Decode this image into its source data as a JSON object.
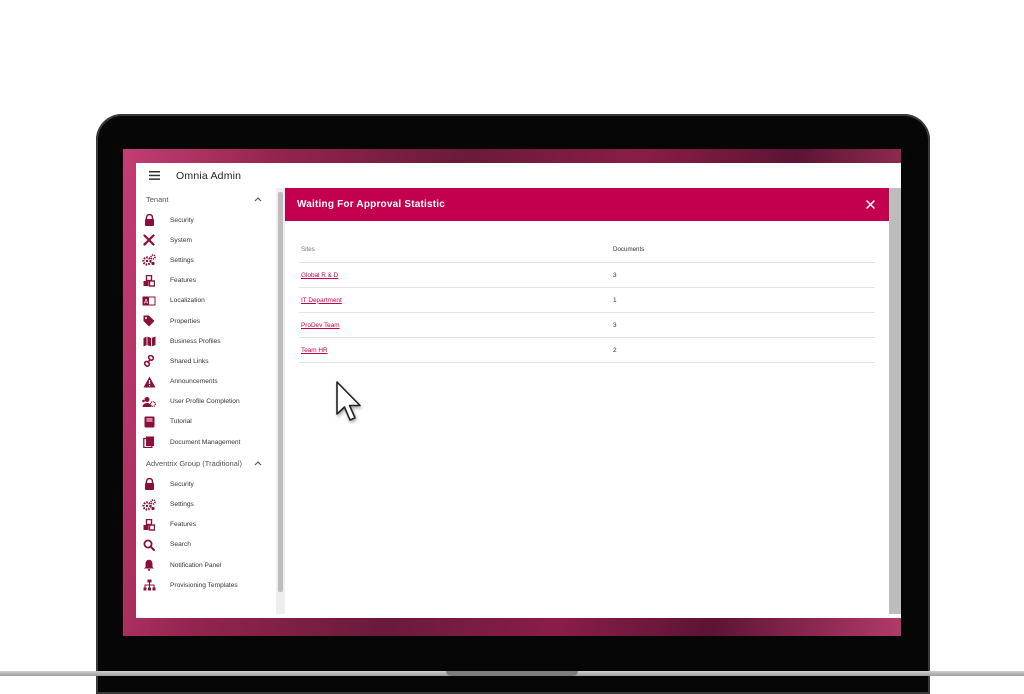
{
  "app": {
    "title": "Omnia Admin"
  },
  "sidebar": {
    "groups": [
      {
        "label": "Tenant",
        "items": [
          {
            "label": "Security",
            "icon": "lock-icon"
          },
          {
            "label": "System",
            "icon": "tools-icon"
          },
          {
            "label": "Settings",
            "icon": "cogs-icon"
          },
          {
            "label": "Features",
            "icon": "cubes-icon"
          },
          {
            "label": "Localization",
            "icon": "language-icon"
          },
          {
            "label": "Properties",
            "icon": "tag-icon"
          },
          {
            "label": "Business Profiles",
            "icon": "map-icon"
          },
          {
            "label": "Shared Links",
            "icon": "link-icon"
          },
          {
            "label": "Announcements",
            "icon": "warning-icon"
          },
          {
            "label": "User Profile Completion",
            "icon": "users-cog-icon"
          },
          {
            "label": "Tutorial",
            "icon": "book-icon"
          },
          {
            "label": "Document Management",
            "icon": "documents-icon"
          }
        ]
      },
      {
        "label": "Adventrix Group (Traditional)",
        "items": [
          {
            "label": "Security",
            "icon": "lock-icon"
          },
          {
            "label": "Settings",
            "icon": "cogs-icon"
          },
          {
            "label": "Features",
            "icon": "cubes-icon"
          },
          {
            "label": "Search",
            "icon": "search-icon"
          },
          {
            "label": "Notification Panel",
            "icon": "bell-icon"
          },
          {
            "label": "Provisioning Templates",
            "icon": "sitemap-icon"
          }
        ]
      }
    ]
  },
  "panel": {
    "title": "Waiting For Approval Statistic",
    "columns": {
      "sites": "Sites",
      "documents": "Documents"
    },
    "rows": [
      {
        "site": "Global R & D",
        "documents": "3"
      },
      {
        "site": "IT Department",
        "documents": "1"
      },
      {
        "site": "ProDev Team",
        "documents": "3"
      },
      {
        "site": "Team HR",
        "documents": "2"
      }
    ]
  },
  "colors": {
    "accent": "#c2004e",
    "icon": "#8b0f3c"
  }
}
